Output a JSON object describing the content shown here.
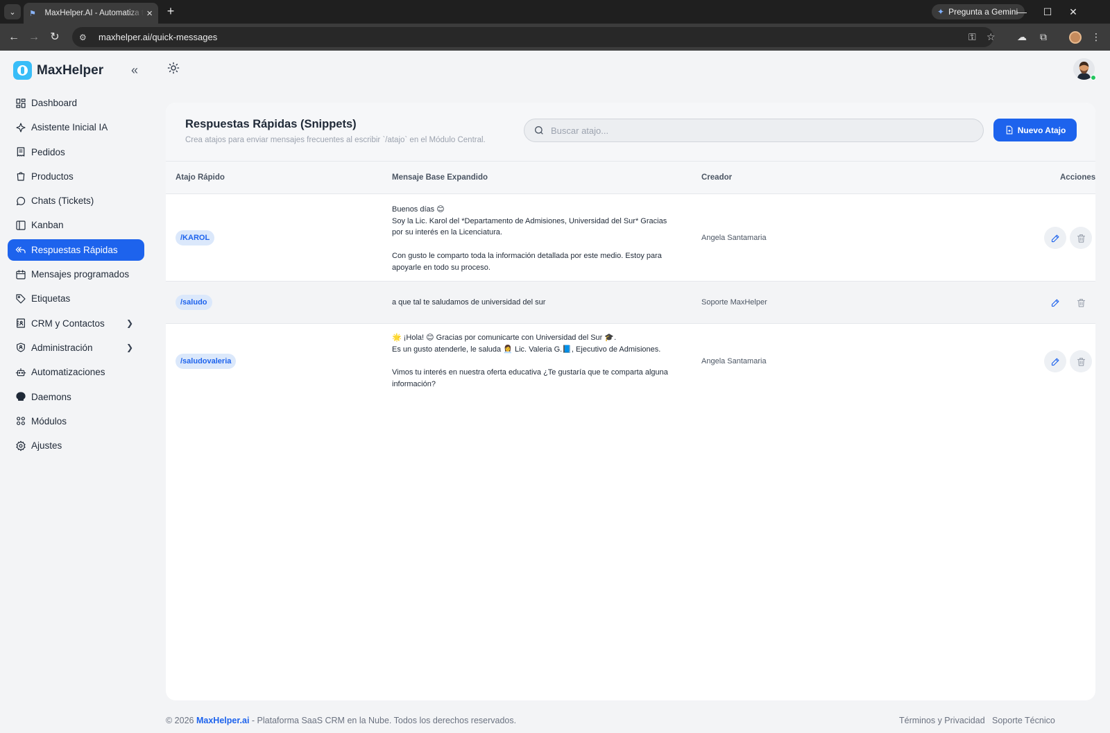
{
  "browser": {
    "tab_title": "MaxHelper.AI - Automatiza tu a",
    "url": "maxhelper.ai/quick-messages",
    "gemini_label": "Pregunta a Gemini"
  },
  "sidebar": {
    "brand": "MaxHelper",
    "items": [
      {
        "label": "Dashboard",
        "icon": "dashboard-icon"
      },
      {
        "label": "Asistente Inicial IA",
        "icon": "sparkle-icon"
      },
      {
        "label": "Pedidos",
        "icon": "receipt-icon"
      },
      {
        "label": "Productos",
        "icon": "shopping-bag-icon"
      },
      {
        "label": "Chats (Tickets)",
        "icon": "whatsapp-icon"
      },
      {
        "label": "Kanban",
        "icon": "kanban-icon"
      },
      {
        "label": "Respuestas Rápidas",
        "icon": "reply-all-icon",
        "active": true
      },
      {
        "label": "Mensajes programados",
        "icon": "calendar-icon"
      },
      {
        "label": "Etiquetas",
        "icon": "tag-icon"
      },
      {
        "label": "CRM y Contactos",
        "icon": "contacts-icon",
        "has_submenu": true
      },
      {
        "label": "Administración",
        "icon": "shield-user-icon",
        "has_submenu": true
      },
      {
        "label": "Automatizaciones",
        "icon": "robot-icon"
      },
      {
        "label": "Daemons",
        "icon": "daemon-icon"
      },
      {
        "label": "Módulos",
        "icon": "modules-icon"
      },
      {
        "label": "Ajustes",
        "icon": "gear-icon"
      }
    ]
  },
  "header": {
    "title": "Respuestas Rápidas (Snippets)",
    "subtitle": "Crea atajos para enviar mensajes frecuentes al escribir `/atajo` en el Módulo Central.",
    "search_placeholder": "Buscar atajo...",
    "new_button": "Nuevo Atajo"
  },
  "table": {
    "columns": [
      "Atajo Rápido",
      "Mensaje Base Expandido",
      "Creador",
      "Acciones"
    ],
    "rows": [
      {
        "shortcut": "/KAROL",
        "message": [
          "Buenos días 😊",
          "Soy la Lic. Karol del *Departamento de Admisiones, Universidad del Sur* Gracias por su interés en la Licenciatura.",
          "",
          "Con gusto le comparto toda la información detallada por este medio. Estoy para apoyarle en todo su proceso."
        ],
        "creator": "Angela Santamaria"
      },
      {
        "shortcut": "/saludo",
        "message": [
          "a que tal te saludamos de universidad del sur"
        ],
        "creator": "Soporte MaxHelper"
      },
      {
        "shortcut": "/saludovaleria",
        "message": [
          "🌟 ¡Hola! 😊 Gracias por comunicarte con Universidad del Sur 🎓.",
          "Es un gusto atenderle, le saluda 👩‍💼 Lic. Valeria G.📘, Ejecutivo de Admisiones.",
          "",
          "Vimos tu interés en nuestra oferta educativa ¿Te gustaría que te comparta alguna información?"
        ],
        "creator": "Angela Santamaria"
      }
    ]
  },
  "footer": {
    "copyright": "© 2026",
    "brand": "MaxHelper.ai",
    "tagline": " - Plataforma SaaS CRM en la Nube. Todos los derechos reservados.",
    "terms": "Términos y Privacidad",
    "support": "Soporte Técnico"
  },
  "colors": {
    "primary": "#1d63ed",
    "brand_logo": "#38bdf8",
    "badge_bg": "#dbe8fb",
    "online": "#22c55e"
  }
}
